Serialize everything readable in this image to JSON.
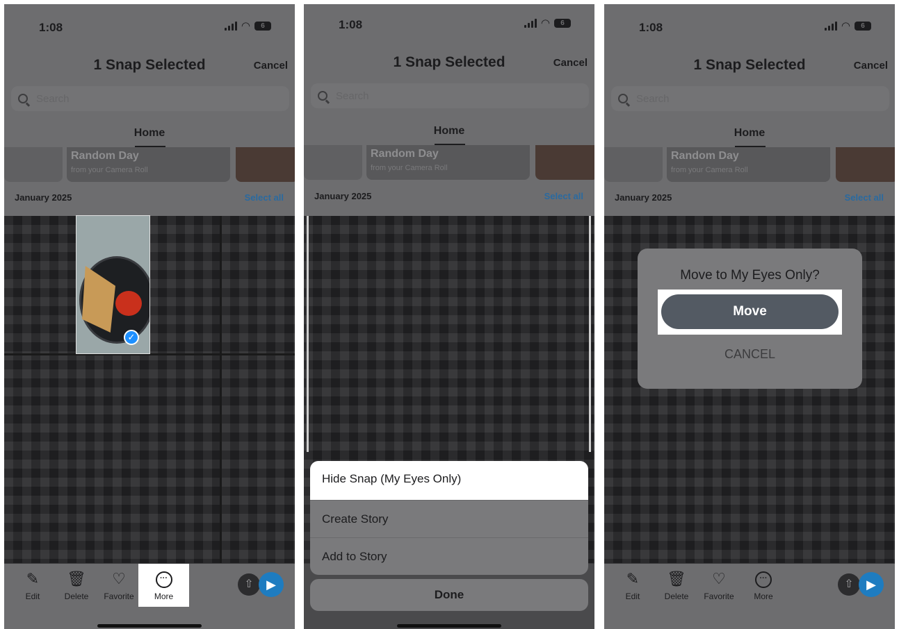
{
  "status": {
    "time": "1:08",
    "battery": "6"
  },
  "header": {
    "title": "1 Snap Selected",
    "cancel_label": "Cancel"
  },
  "search": {
    "placeholder": "Search"
  },
  "tabs": {
    "home_label": "Home"
  },
  "memory_card": {
    "title": "Random Day",
    "subtitle": "from your Camera Roll"
  },
  "section": {
    "month": "January 2025",
    "select_all": "Select all"
  },
  "toolbar": {
    "items": [
      {
        "label": "Edit",
        "icon": "pencil-icon"
      },
      {
        "label": "Delete",
        "icon": "trash-icon"
      },
      {
        "label": "Favorite",
        "icon": "heart-icon"
      },
      {
        "label": "More",
        "icon": "ellipsis-circle-icon"
      }
    ]
  },
  "action_sheet": {
    "items": [
      "Hide Snap (My Eyes Only)",
      "Create Story",
      "Add to Story"
    ],
    "done_label": "Done"
  },
  "dialog": {
    "title": "Move to My Eyes Only?",
    "move_label": "Move",
    "cancel_label": "CANCEL"
  },
  "colors": {
    "accent_blue": "#1e90ff",
    "send_blue": "#1e7cc0",
    "move_button": "#535a63"
  }
}
